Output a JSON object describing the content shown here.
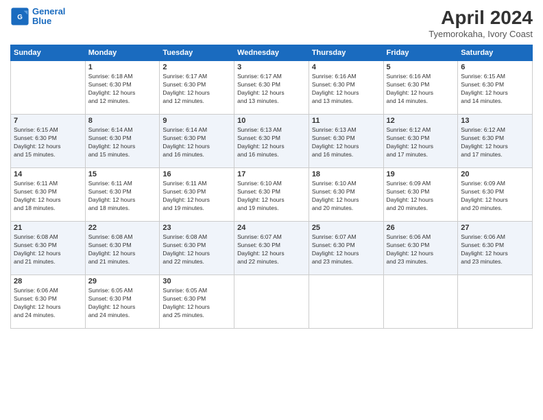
{
  "logo": {
    "line1": "General",
    "line2": "Blue"
  },
  "title": "April 2024",
  "location": "Tyemorokaha, Ivory Coast",
  "header_row": [
    "Sunday",
    "Monday",
    "Tuesday",
    "Wednesday",
    "Thursday",
    "Friday",
    "Saturday"
  ],
  "weeks": [
    [
      {
        "day": "",
        "info": ""
      },
      {
        "day": "1",
        "info": "Sunrise: 6:18 AM\nSunset: 6:30 PM\nDaylight: 12 hours\nand 12 minutes."
      },
      {
        "day": "2",
        "info": "Sunrise: 6:17 AM\nSunset: 6:30 PM\nDaylight: 12 hours\nand 12 minutes."
      },
      {
        "day": "3",
        "info": "Sunrise: 6:17 AM\nSunset: 6:30 PM\nDaylight: 12 hours\nand 13 minutes."
      },
      {
        "day": "4",
        "info": "Sunrise: 6:16 AM\nSunset: 6:30 PM\nDaylight: 12 hours\nand 13 minutes."
      },
      {
        "day": "5",
        "info": "Sunrise: 6:16 AM\nSunset: 6:30 PM\nDaylight: 12 hours\nand 14 minutes."
      },
      {
        "day": "6",
        "info": "Sunrise: 6:15 AM\nSunset: 6:30 PM\nDaylight: 12 hours\nand 14 minutes."
      }
    ],
    [
      {
        "day": "7",
        "info": "Sunrise: 6:15 AM\nSunset: 6:30 PM\nDaylight: 12 hours\nand 15 minutes."
      },
      {
        "day": "8",
        "info": "Sunrise: 6:14 AM\nSunset: 6:30 PM\nDaylight: 12 hours\nand 15 minutes."
      },
      {
        "day": "9",
        "info": "Sunrise: 6:14 AM\nSunset: 6:30 PM\nDaylight: 12 hours\nand 16 minutes."
      },
      {
        "day": "10",
        "info": "Sunrise: 6:13 AM\nSunset: 6:30 PM\nDaylight: 12 hours\nand 16 minutes."
      },
      {
        "day": "11",
        "info": "Sunrise: 6:13 AM\nSunset: 6:30 PM\nDaylight: 12 hours\nand 16 minutes."
      },
      {
        "day": "12",
        "info": "Sunrise: 6:12 AM\nSunset: 6:30 PM\nDaylight: 12 hours\nand 17 minutes."
      },
      {
        "day": "13",
        "info": "Sunrise: 6:12 AM\nSunset: 6:30 PM\nDaylight: 12 hours\nand 17 minutes."
      }
    ],
    [
      {
        "day": "14",
        "info": "Sunrise: 6:11 AM\nSunset: 6:30 PM\nDaylight: 12 hours\nand 18 minutes."
      },
      {
        "day": "15",
        "info": "Sunrise: 6:11 AM\nSunset: 6:30 PM\nDaylight: 12 hours\nand 18 minutes."
      },
      {
        "day": "16",
        "info": "Sunrise: 6:11 AM\nSunset: 6:30 PM\nDaylight: 12 hours\nand 19 minutes."
      },
      {
        "day": "17",
        "info": "Sunrise: 6:10 AM\nSunset: 6:30 PM\nDaylight: 12 hours\nand 19 minutes."
      },
      {
        "day": "18",
        "info": "Sunrise: 6:10 AM\nSunset: 6:30 PM\nDaylight: 12 hours\nand 20 minutes."
      },
      {
        "day": "19",
        "info": "Sunrise: 6:09 AM\nSunset: 6:30 PM\nDaylight: 12 hours\nand 20 minutes."
      },
      {
        "day": "20",
        "info": "Sunrise: 6:09 AM\nSunset: 6:30 PM\nDaylight: 12 hours\nand 20 minutes."
      }
    ],
    [
      {
        "day": "21",
        "info": "Sunrise: 6:08 AM\nSunset: 6:30 PM\nDaylight: 12 hours\nand 21 minutes."
      },
      {
        "day": "22",
        "info": "Sunrise: 6:08 AM\nSunset: 6:30 PM\nDaylight: 12 hours\nand 21 minutes."
      },
      {
        "day": "23",
        "info": "Sunrise: 6:08 AM\nSunset: 6:30 PM\nDaylight: 12 hours\nand 22 minutes."
      },
      {
        "day": "24",
        "info": "Sunrise: 6:07 AM\nSunset: 6:30 PM\nDaylight: 12 hours\nand 22 minutes."
      },
      {
        "day": "25",
        "info": "Sunrise: 6:07 AM\nSunset: 6:30 PM\nDaylight: 12 hours\nand 23 minutes."
      },
      {
        "day": "26",
        "info": "Sunrise: 6:06 AM\nSunset: 6:30 PM\nDaylight: 12 hours\nand 23 minutes."
      },
      {
        "day": "27",
        "info": "Sunrise: 6:06 AM\nSunset: 6:30 PM\nDaylight: 12 hours\nand 23 minutes."
      }
    ],
    [
      {
        "day": "28",
        "info": "Sunrise: 6:06 AM\nSunset: 6:30 PM\nDaylight: 12 hours\nand 24 minutes."
      },
      {
        "day": "29",
        "info": "Sunrise: 6:05 AM\nSunset: 6:30 PM\nDaylight: 12 hours\nand 24 minutes."
      },
      {
        "day": "30",
        "info": "Sunrise: 6:05 AM\nSunset: 6:30 PM\nDaylight: 12 hours\nand 25 minutes."
      },
      {
        "day": "",
        "info": ""
      },
      {
        "day": "",
        "info": ""
      },
      {
        "day": "",
        "info": ""
      },
      {
        "day": "",
        "info": ""
      }
    ]
  ]
}
